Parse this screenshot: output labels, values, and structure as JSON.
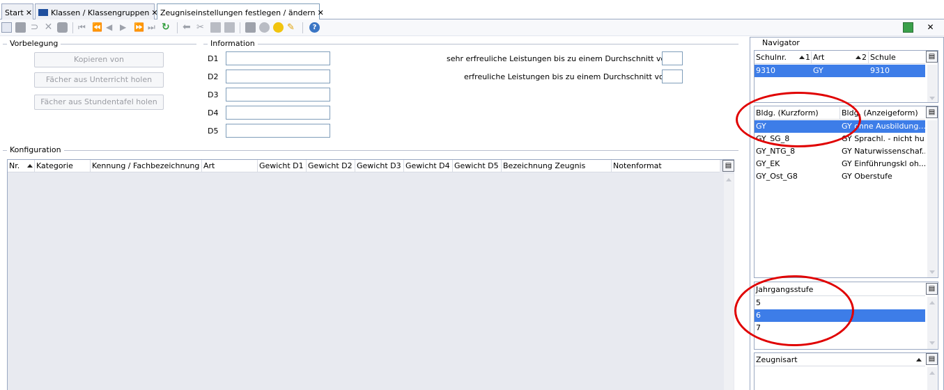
{
  "tabs": [
    {
      "label": "Start"
    },
    {
      "label": "Klassen / Klassengruppen"
    },
    {
      "label": "Zeugniseinstellungen festlegen / ändern"
    }
  ],
  "toolbar": {
    "icons": [
      "new-icon",
      "save-icon",
      "undo-icon",
      "delete-icon",
      "stop-icon",
      "first-icon",
      "prev-page-icon",
      "prev-icon",
      "next-icon",
      "next-page-icon",
      "last-icon",
      "refresh-icon",
      "back-icon",
      "cut-icon",
      "copy-icon",
      "paste-icon",
      "print-icon",
      "preview-icon",
      "idea-icon",
      "pencil-icon",
      "help-icon"
    ]
  },
  "vorbelegung": {
    "title": "Vorbelegung",
    "buttons": [
      "Kopieren von",
      "Fächer aus Unterricht holen",
      "Fächer aus Stundentafel holen"
    ]
  },
  "information": {
    "title": "Information",
    "fields": [
      "D1",
      "D2",
      "D3",
      "D4",
      "D5"
    ],
    "sehr_label": "sehr erfreuliche Leistungen bis zu einem Durchschnitt von",
    "erfreulich_label": "erfreuliche Leistungen bis zu einem Durchschnitt von"
  },
  "konfiguration": {
    "title": "Konfiguration",
    "columns": [
      "Nr.",
      "Kategorie",
      "Kennung / Fachbezeichnung",
      "Art",
      "Gewicht D1",
      "Gewicht D2",
      "Gewicht D3",
      "Gewicht D4",
      "Gewicht D5",
      "Bezeichnung Zeugnis",
      "Notenformat"
    ]
  },
  "navigator": {
    "title": "Navigator",
    "schule": {
      "columns": [
        "Schulnr.",
        "1",
        "Art",
        "2",
        "Schule"
      ],
      "rows": [
        {
          "schulnr": "9310",
          "art": "GY",
          "schule": "9310"
        }
      ]
    },
    "bildung": {
      "columns": [
        "Bldg. (Kurzform)",
        "Bldg. (Anzeigeform)"
      ],
      "rows": [
        {
          "kurz": "GY",
          "anzeige": "GY ohne Ausbildung..."
        },
        {
          "kurz": "GY_SG_8",
          "anzeige": "GY Sprachl. - nicht hu..."
        },
        {
          "kurz": "GY_NTG_8",
          "anzeige": "GY Naturwissenschaf..."
        },
        {
          "kurz": "GY_EK",
          "anzeige": "GY Einführungskl oh..."
        },
        {
          "kurz": "GY_Ost_G8",
          "anzeige": "GY Oberstufe"
        }
      ]
    },
    "jahrgang": {
      "column": "Jahrgangsstufe",
      "rows": [
        "5",
        "6",
        "7"
      ]
    },
    "zeugnisart": {
      "column": "Zeugnisart"
    }
  },
  "colors": {
    "selection": "#3d7de8",
    "annotation": "#e00000",
    "grid_bg": "#e8eaf0"
  }
}
